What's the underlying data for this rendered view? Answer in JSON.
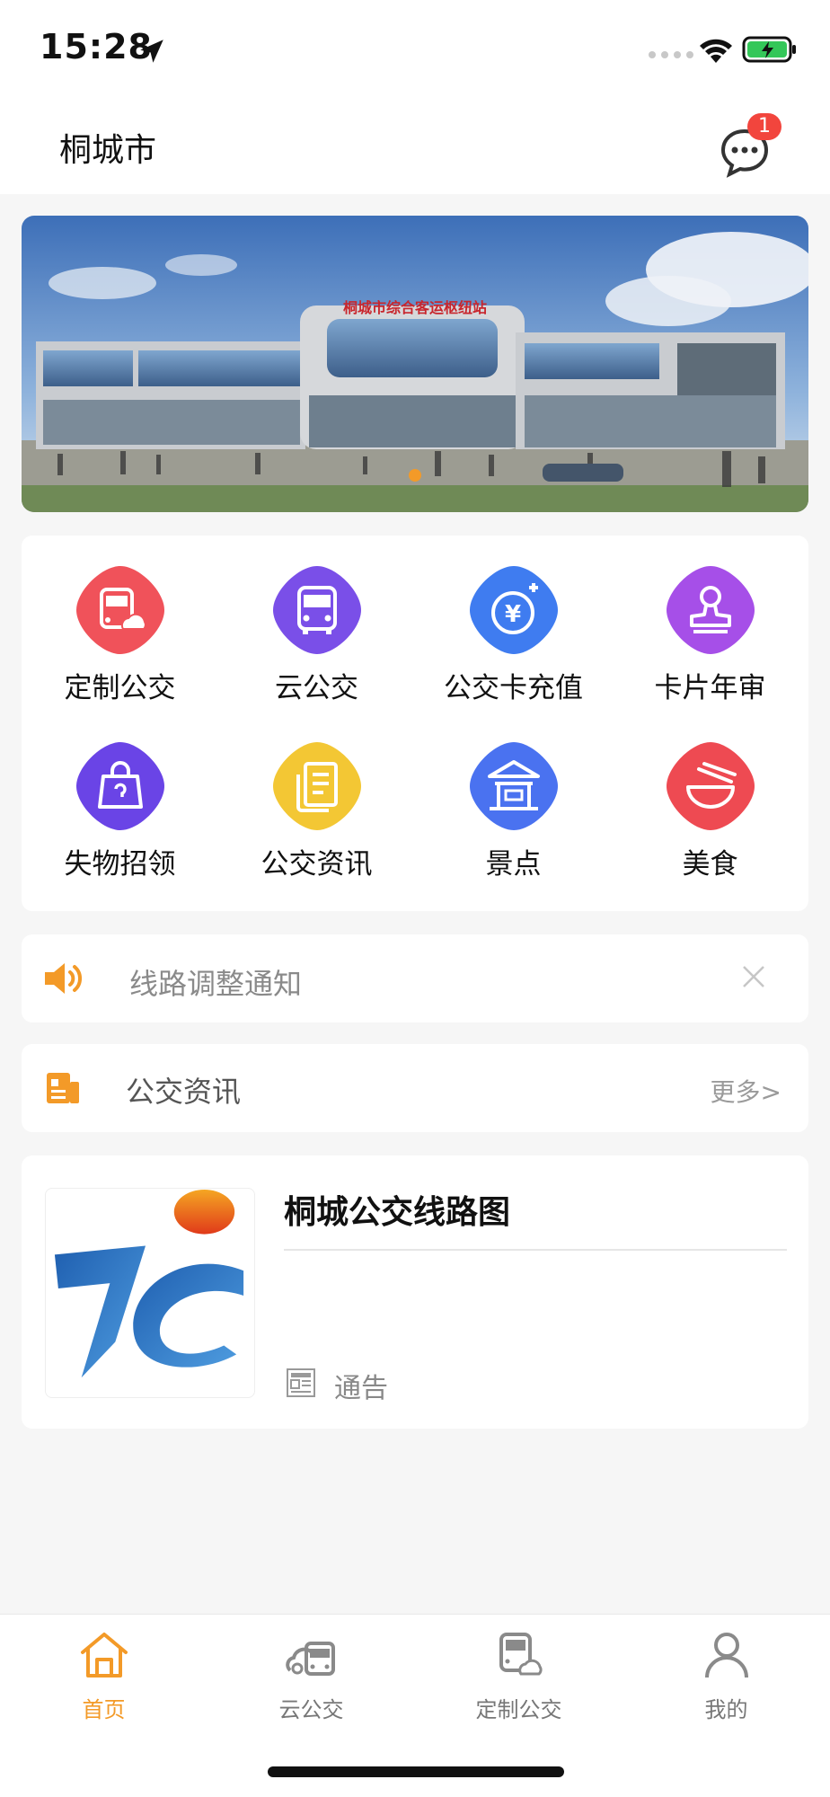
{
  "status_bar": {
    "time": "15:28"
  },
  "header": {
    "city": "桐城市",
    "message_badge": "1"
  },
  "banner": {
    "sign_text": "桐城市综合客运枢纽站",
    "slide_count": 1,
    "active_slide": 1
  },
  "grid": {
    "items": [
      {
        "label": "定制公交",
        "icon": "custom-bus-icon",
        "color": "#f0525a"
      },
      {
        "label": "云公交",
        "icon": "bus-icon",
        "color": "#7a4fe8"
      },
      {
        "label": "公交卡充值",
        "icon": "card-recharge-icon",
        "color": "#3f7cf0"
      },
      {
        "label": "卡片年审",
        "icon": "stamp-icon",
        "color": "#a64fe8"
      },
      {
        "label": "失物招领",
        "icon": "lost-found-bag-icon",
        "color": "#6a44e6"
      },
      {
        "label": "公交资讯",
        "icon": "news-doc-icon",
        "color": "#f3c734"
      },
      {
        "label": "景点",
        "icon": "pavilion-icon",
        "color": "#4a72f0"
      },
      {
        "label": "美食",
        "icon": "food-bowl-icon",
        "color": "#ee4a52"
      }
    ]
  },
  "notice": {
    "text": "线路调整通知"
  },
  "news": {
    "title": "公交资讯",
    "more": "更多>"
  },
  "article": {
    "title": "桐城公交线路图",
    "tag": "通告"
  },
  "tabbar": {
    "tabs": [
      {
        "label": "首页",
        "icon": "home-icon",
        "active": true
      },
      {
        "label": "云公交",
        "icon": "cloud-bus-icon",
        "active": false
      },
      {
        "label": "定制公交",
        "icon": "custom-bus-icon",
        "active": false
      },
      {
        "label": "我的",
        "icon": "profile-icon",
        "active": false
      }
    ]
  },
  "colors": {
    "accent": "#f39a28",
    "background": "#f6f6f6"
  }
}
